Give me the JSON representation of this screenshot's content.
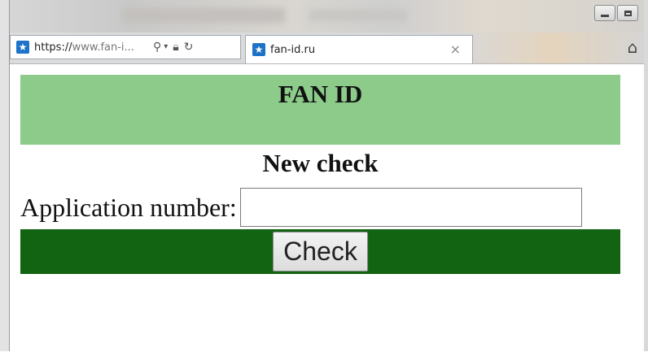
{
  "browser": {
    "address_bar": {
      "url_scheme": "https://",
      "url_rest": "www.fan-i...",
      "icons": [
        "search-icon",
        "dropdown-icon",
        "lock-icon",
        "refresh-icon"
      ]
    },
    "tab": {
      "title": "fan-id.ru",
      "close_label": "×"
    },
    "window_controls": [
      "minimize",
      "maximize"
    ],
    "home_icon": "home-icon"
  },
  "page": {
    "header_title": "FAN ID",
    "subtitle": "New check",
    "form": {
      "label": "Application number:",
      "input_value": "",
      "button_label": "Check"
    }
  },
  "colors": {
    "header_bg": "#8ccb8a",
    "action_bar_bg": "#136412"
  }
}
